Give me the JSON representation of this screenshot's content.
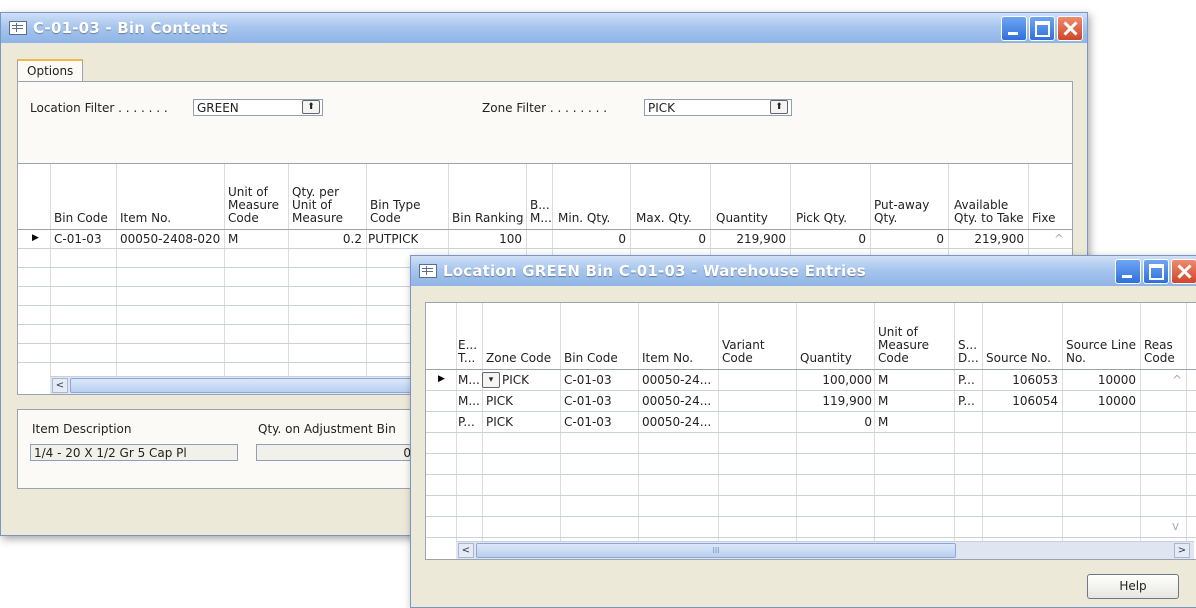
{
  "win1": {
    "title": "C-01-03  - Bin Contents",
    "tab_options": "Options",
    "location_filter_label": "Location Filter . . . . . . .",
    "location_filter_value": "GREEN",
    "zone_filter_label": "Zone Filter . . . . . . . .",
    "zone_filter_value": "PICK",
    "columns": [
      "Bin Code",
      "Item No.",
      "Unit of\nMeasure\nCode",
      "Qty. per\nUnit of\nMeasure",
      "Bin Type\nCode",
      "Bin Ranking",
      "B...\nM...",
      "Min. Qty.",
      "Max. Qty.",
      "Quantity",
      "Pick Qty.",
      "Put-away\nQty.",
      "Available\nQty. to Take",
      "Fixe"
    ],
    "row": {
      "bin_code": "C-01-03",
      "item_no": "00050-2408-020",
      "uom": "M",
      "qty_per_uom": "0.2",
      "bin_type": "PUTPICK",
      "bin_ranking": "100",
      "min_qty": "0",
      "max_qty": "0",
      "quantity": "219,900",
      "pick_qty": "0",
      "putaway_qty": "0",
      "available": "219,900"
    },
    "item_description_label": "Item Description",
    "item_description_value": "1/4 - 20 X 1/2 Gr 5 Cap Pl",
    "qty_adjustment_label": "Qty. on Adjustment Bin",
    "qty_adjustment_value": "0"
  },
  "win2": {
    "title": "Location GREEN Bin C-01-03 - Warehouse Entries",
    "columns": [
      "E...\nT...",
      "Zone Code",
      "Bin Code",
      "Item No.",
      "Variant\nCode",
      "Quantity",
      "Unit of\nMeasure\nCode",
      "S...\nD...",
      "Source No.",
      "Source Line\nNo.",
      "Reas\nCode"
    ],
    "rows": [
      {
        "entry_type": "M...",
        "zone": "PICK",
        "bin": "C-01-03",
        "item": "00050-24...",
        "variant": "",
        "qty": "100,000",
        "uom": "M",
        "sd": "P...",
        "source_no": "106053",
        "source_line": "10000"
      },
      {
        "entry_type": "M...",
        "zone": "PICK",
        "bin": "C-01-03",
        "item": "00050-24...",
        "variant": "",
        "qty": "119,900",
        "uom": "M",
        "sd": "P...",
        "source_no": "106054",
        "source_line": "10000"
      },
      {
        "entry_type": "P...",
        "zone": "PICK",
        "bin": "C-01-03",
        "item": "00050-24...",
        "variant": "",
        "qty": "0",
        "uom": "M",
        "sd": "",
        "source_no": "",
        "source_line": ""
      }
    ],
    "help_label": "Help",
    "scroll_glyph": "III"
  },
  "icons": {
    "row_selector": "▶",
    "dropdown": "▾",
    "lookup": "⬆",
    "scroll_left": "<",
    "scroll_right": ">",
    "scroll_up": "^",
    "scroll_down": "v"
  }
}
